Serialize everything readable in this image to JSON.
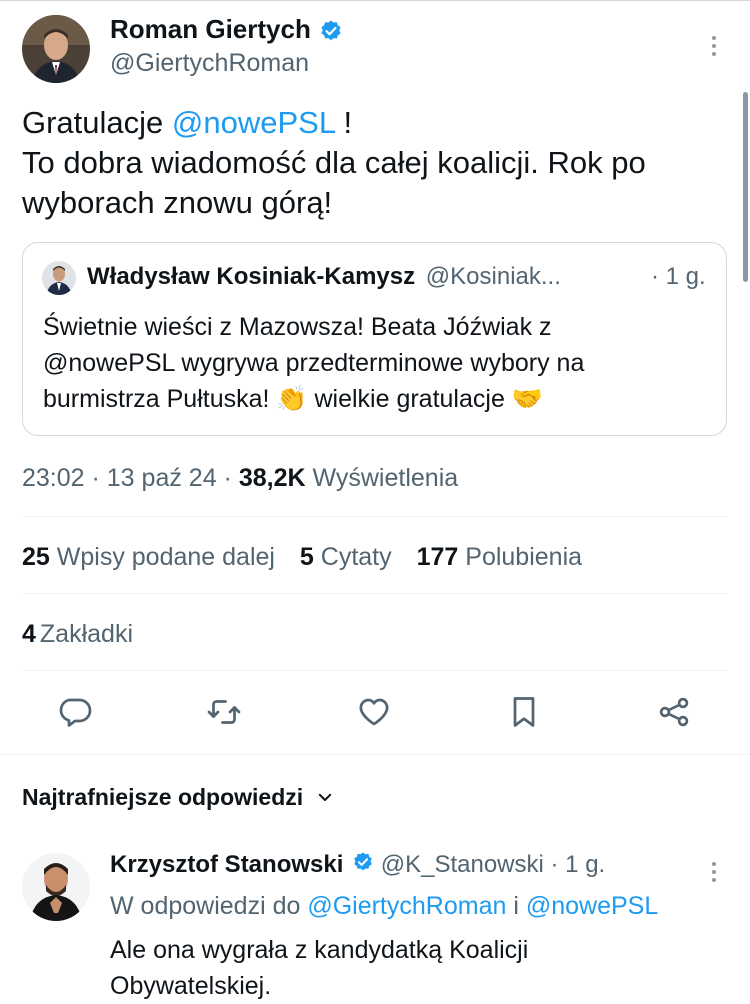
{
  "tweet": {
    "author_name": "Roman Giertych",
    "author_handle": "@GiertychRoman",
    "text_line1_before": "Gratulacje ",
    "text_mention": "@nowePSL",
    "text_line1_after": " !",
    "text_line2": "To dobra wiadomość dla całej koalicji. Rok po",
    "text_line3": "wyborach znowu górą!"
  },
  "quote": {
    "author_name": "Władysław Kosiniak-Kamysz",
    "author_handle": "@Kosiniak...",
    "time": "· 1 g.",
    "line1": "Świetnie wieści z Mazowsza! Beata Jóźwiak z",
    "line2": "@nowePSL wygrywa przedterminowe wybory na",
    "line3": "burmistrza Pułtuska! 👏 wielkie gratulacje 🤝"
  },
  "meta": {
    "time": "23:02",
    "sep1": " · ",
    "date": "13 paź 24",
    "sep2": " · ",
    "views_count": "38,2K",
    "views_label": " Wyświetlenia"
  },
  "stats": {
    "retweets_count": "25",
    "retweets_label": "Wpisy podane dalej",
    "quotes_count": "5",
    "quotes_label": "Cytaty",
    "likes_count": "177",
    "likes_label": "Polubienia",
    "bookmarks_count": "4",
    "bookmarks_label": "Zakładki"
  },
  "actions": [
    "reply-icon",
    "retweet-icon",
    "like-icon",
    "bookmark-icon",
    "share-icon"
  ],
  "replies_header": "Najtrafniejsze odpowiedzi",
  "reply": {
    "author_name": "Krzysztof Stanowski",
    "author_handle": "@K_Stanowski",
    "time": "· 1 g.",
    "in_reply_prefix": "W odpowiedzi do ",
    "in_reply_user1": "@GiertychRoman",
    "in_reply_and": " i ",
    "in_reply_user2": "@nowePSL",
    "line1": "Ale ona wygrała z kandydatką Koalicji",
    "line2": "Obywatelskiej."
  },
  "colors": {
    "accent": "#1d9bf0",
    "text": "#0f1419",
    "secondary": "#536471",
    "border": "#cfd9de"
  }
}
